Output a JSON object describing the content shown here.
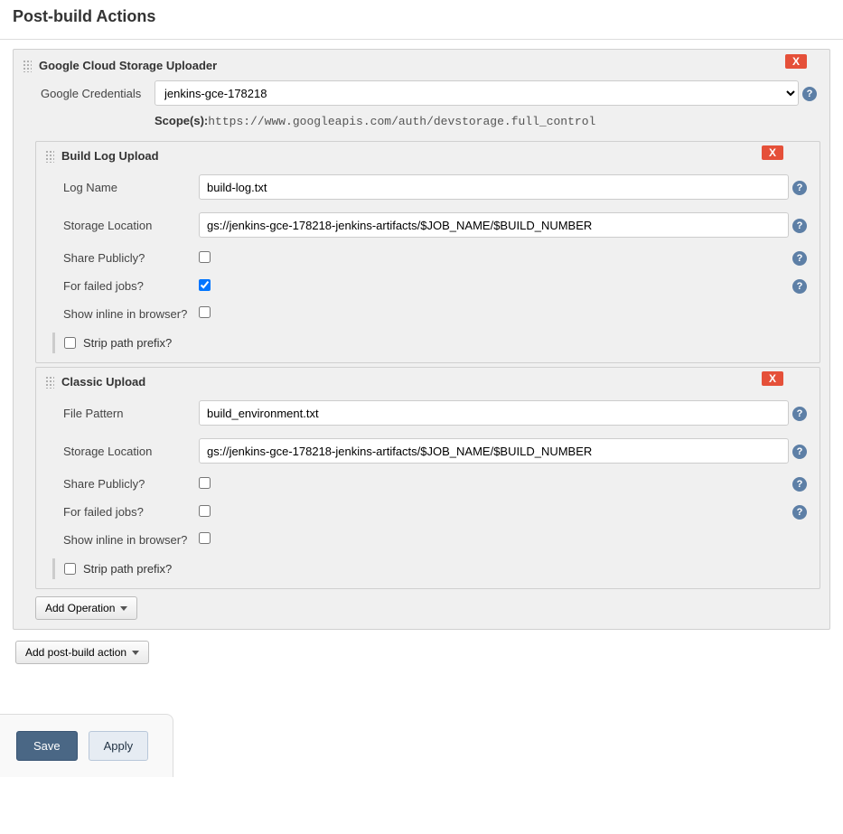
{
  "page": {
    "title": "Post-build Actions"
  },
  "uploader": {
    "title": "Google Cloud Storage Uploader",
    "delete": "X",
    "credentials_label": "Google Credentials",
    "credentials_value": "jenkins-gce-178218",
    "scopes_label": "Scope(s):",
    "scopes_value": "https://www.googleapis.com/auth/devstorage.full_control"
  },
  "build_log": {
    "title": "Build Log Upload",
    "delete": "X",
    "log_name_label": "Log Name",
    "log_name_value": "build-log.txt",
    "storage_label": "Storage Location",
    "storage_value": "gs://jenkins-gce-178218-jenkins-artifacts/$JOB_NAME/$BUILD_NUMBER",
    "share_label": "Share Publicly?",
    "failed_label": "For failed jobs?",
    "inline_label": "Show inline in browser?",
    "strip_label": "Strip path prefix?"
  },
  "classic": {
    "title": "Classic Upload",
    "delete": "X",
    "pattern_label": "File Pattern",
    "pattern_value": "build_environment.txt",
    "storage_label": "Storage Location",
    "storage_value": "gs://jenkins-gce-178218-jenkins-artifacts/$JOB_NAME/$BUILD_NUMBER",
    "share_label": "Share Publicly?",
    "failed_label": "For failed jobs?",
    "inline_label": "Show inline in browser?",
    "strip_label": "Strip path prefix?"
  },
  "buttons": {
    "add_op": "Add Operation",
    "add_post": "Add post-build action",
    "save": "Save",
    "apply": "Apply"
  },
  "help": "?"
}
